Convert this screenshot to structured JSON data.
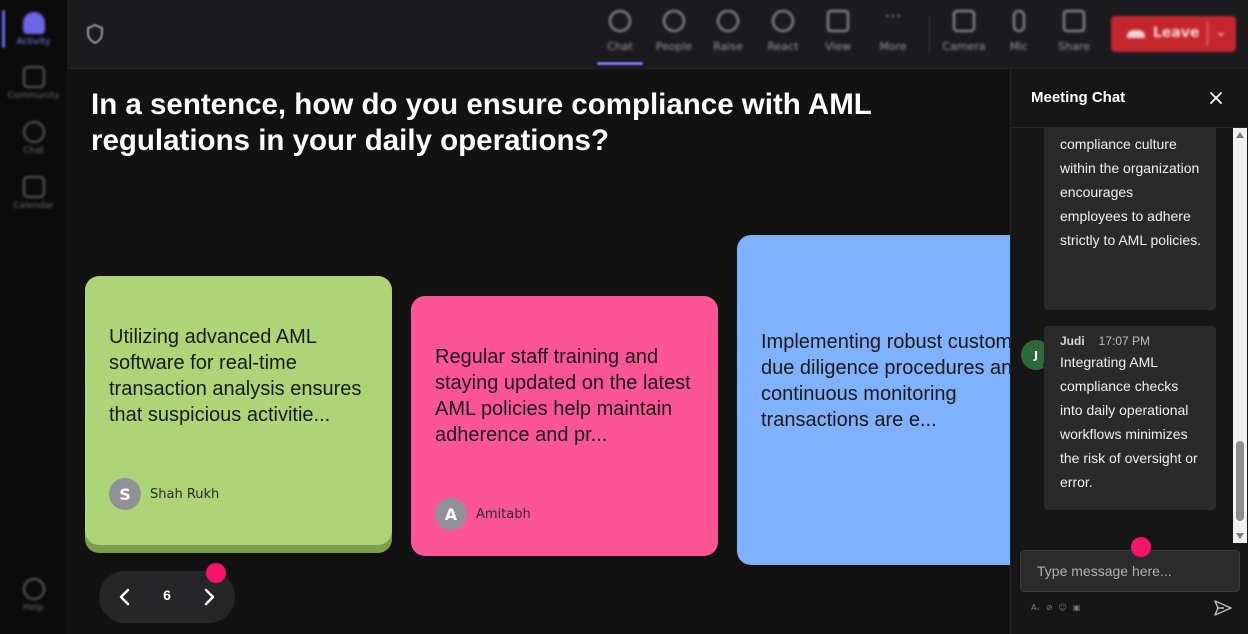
{
  "rail": {
    "items": [
      {
        "label": "Activity",
        "active": true
      },
      {
        "label": "Community"
      },
      {
        "label": "Chat"
      },
      {
        "label": "Calendar"
      }
    ],
    "help_label": "Help"
  },
  "toolbar": {
    "buttons": [
      {
        "label": "Chat",
        "icon": "chat-icon"
      },
      {
        "label": "People",
        "icon": "people-icon"
      },
      {
        "label": "Raise",
        "icon": "raise-hand-icon"
      },
      {
        "label": "React",
        "icon": "react-icon"
      },
      {
        "label": "View",
        "icon": "view-icon"
      },
      {
        "label": "More",
        "icon": "more-icon"
      },
      {
        "label": "Camera",
        "icon": "camera-off-icon"
      },
      {
        "label": "Mic",
        "icon": "mic-icon"
      },
      {
        "label": "Share",
        "icon": "share-icon"
      }
    ],
    "leave_label": "Leave",
    "leave_color": "#c4262e"
  },
  "stage": {
    "question": "In a sentence, how do you ensure compliance with AML regulations in your daily operations?",
    "cards": [
      {
        "text": "Utilizing advanced AML software for real-time transaction analysis ensures that suspicious activitie...",
        "author": "Shah Rukh",
        "initial": "S",
        "color": "#add477"
      },
      {
        "text": "Regular staff training and staying updated on the latest AML policies help maintain adherence and pr...",
        "author": "Amitabh",
        "initial": "A",
        "color": "#fc5596"
      },
      {
        "text": "Implementing robust customer due diligence procedures and continuous monitoring transactions are e...",
        "color": "#80b1fc"
      }
    ],
    "pager": {
      "current": "6"
    }
  },
  "chat": {
    "title": "Meeting Chat",
    "messages": [
      {
        "text": "compliance culture within the organization encourages employees to adhere strictly to AML policies."
      },
      {
        "author": "Judi",
        "initial": "J",
        "time": "17:07 PM",
        "text": "Integrating AML compliance checks into daily operational workflows minimizes the risk of oversight or error."
      }
    ],
    "input_placeholder": "Type message here..."
  },
  "colors": {
    "accent": "#6b66e8",
    "notification_dot": "#f7146b"
  }
}
